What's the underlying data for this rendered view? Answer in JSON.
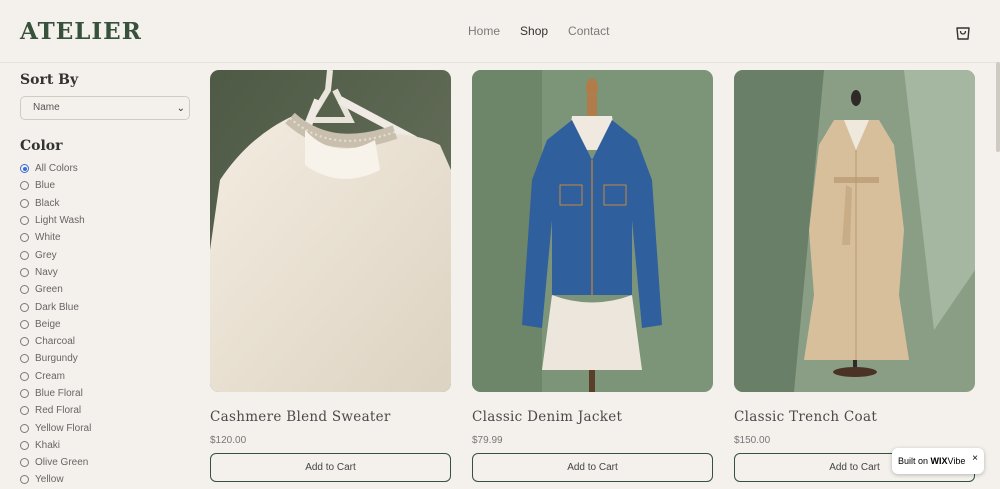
{
  "header": {
    "logo": "ATELIER",
    "nav": [
      "Home",
      "Shop",
      "Contact"
    ],
    "active_nav": "Shop",
    "cart_icon": "shopping-bag-icon"
  },
  "sidebar": {
    "sort_heading": "Sort By",
    "sort_value": "Name",
    "color_heading": "Color",
    "colors": [
      "All Colors",
      "Blue",
      "Black",
      "Light Wash",
      "White",
      "Grey",
      "Navy",
      "Green",
      "Dark Blue",
      "Beige",
      "Charcoal",
      "Burgundy",
      "Cream",
      "Blue Floral",
      "Red Floral",
      "Yellow Floral",
      "Khaki",
      "Olive Green",
      "Yellow"
    ],
    "selected_color": "All Colors"
  },
  "products": [
    {
      "name": "Cashmere Blend Sweater",
      "price": "$120.00",
      "button": "Add to Cart"
    },
    {
      "name": "Classic Denim Jacket",
      "price": "$79.99",
      "button": "Add to Cart"
    },
    {
      "name": "Classic Trench Coat",
      "price": "$150.00",
      "button": "Add to Cart"
    }
  ],
  "badge": {
    "prefix": "Built on",
    "brand": "WIX",
    "suffix": "Vibe",
    "close": "×"
  },
  "colors": {
    "accent": "#37513c",
    "background": "#f4f1ec",
    "radio": "#3a6fd8"
  }
}
